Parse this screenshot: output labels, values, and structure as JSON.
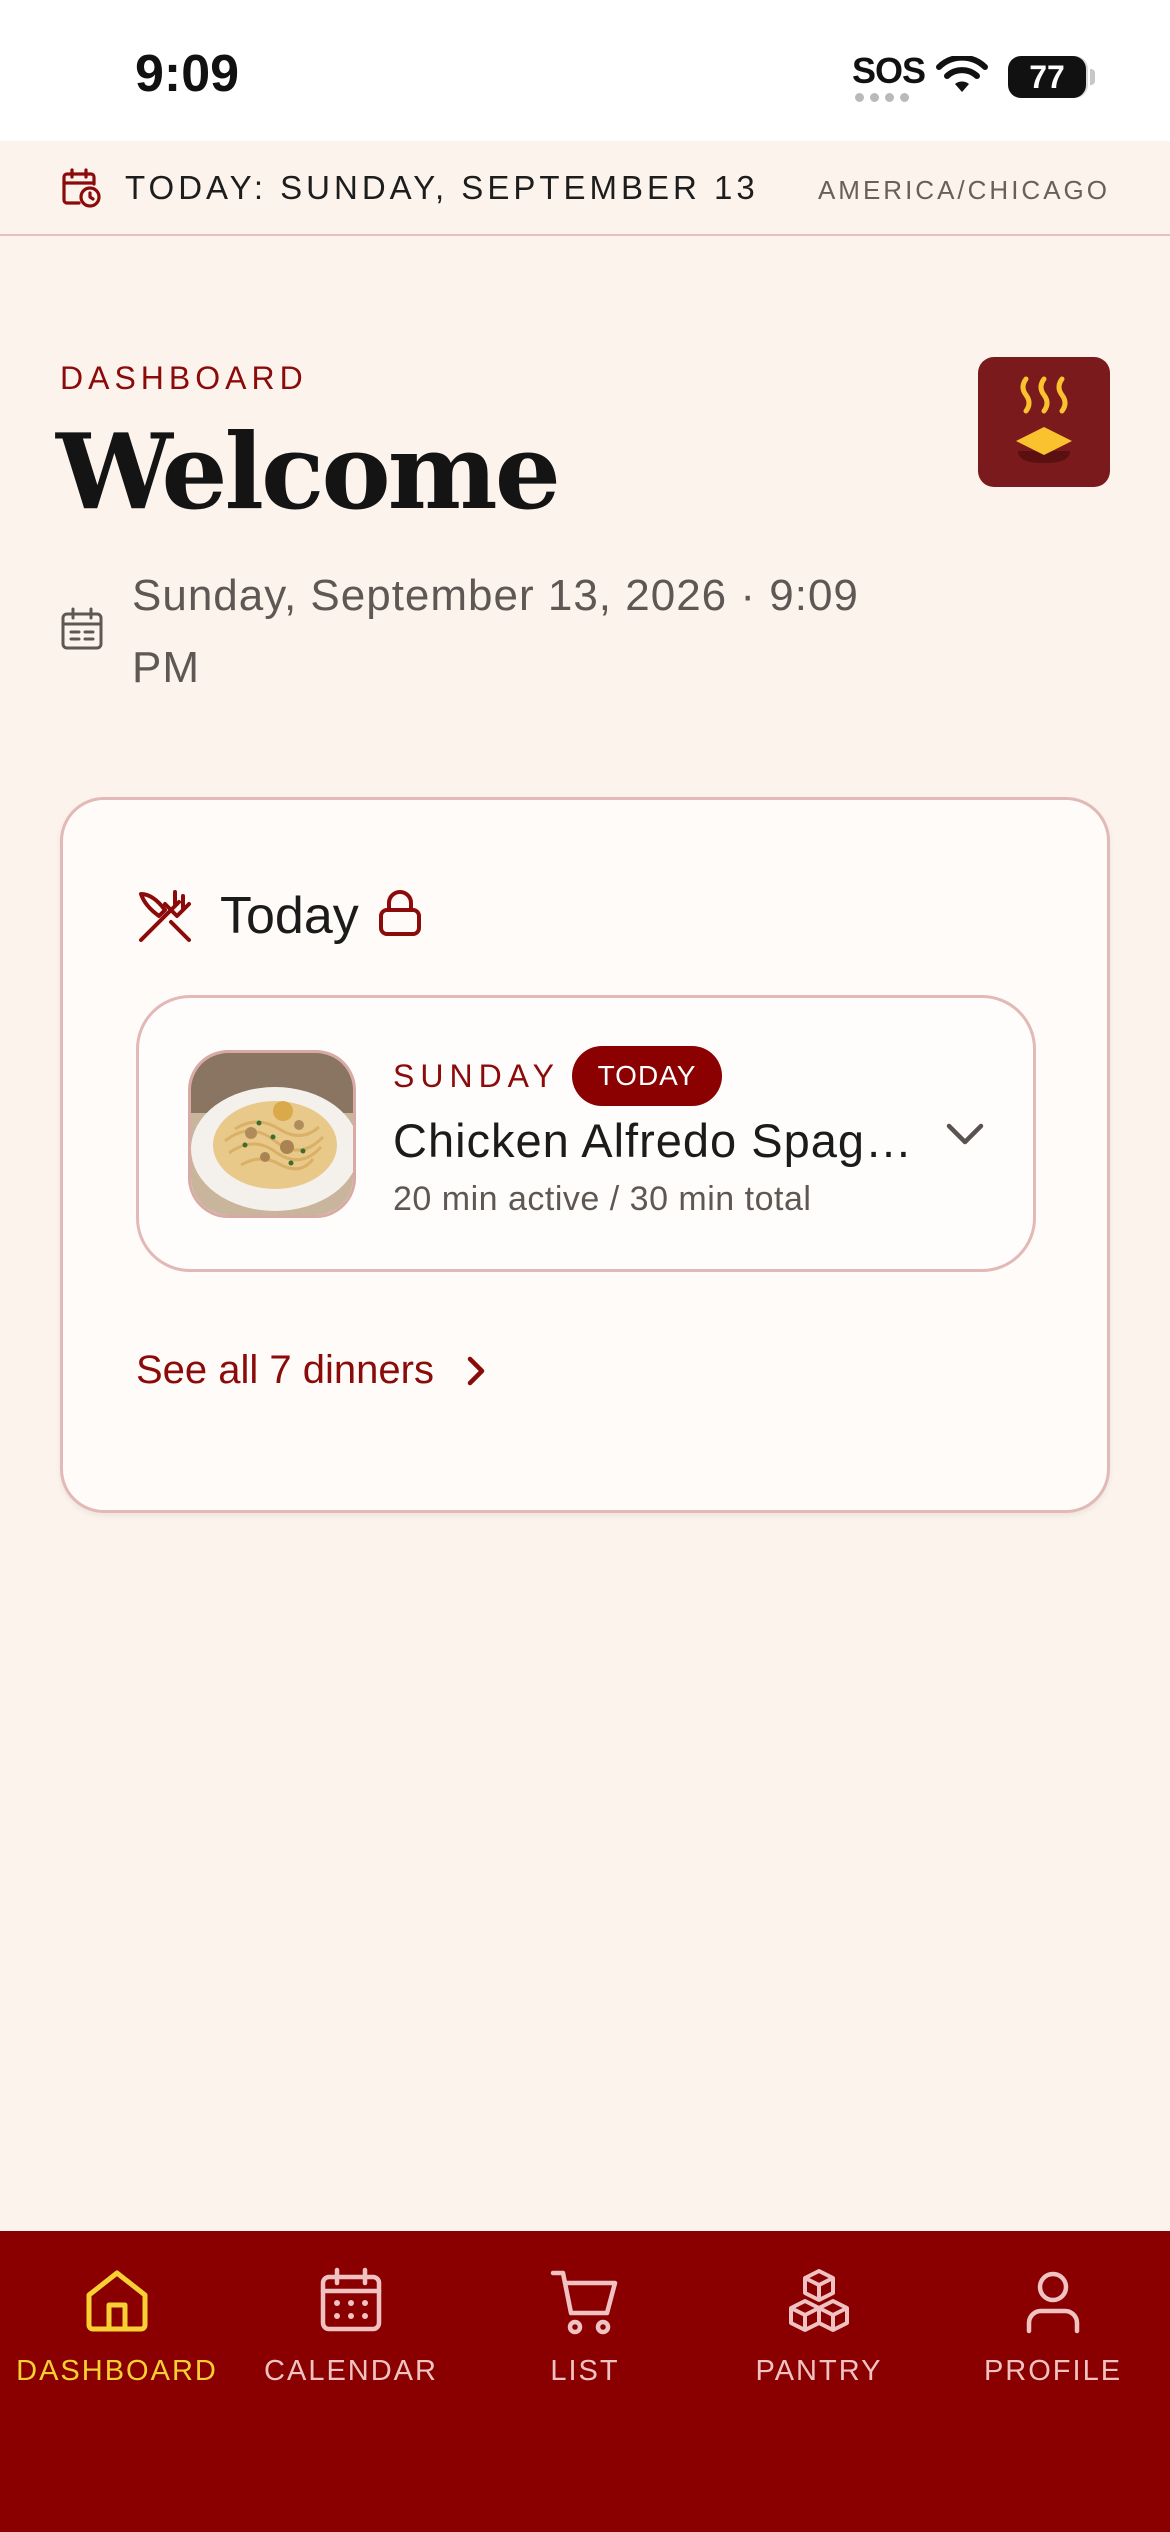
{
  "status_bar": {
    "time": "9:09",
    "sos": "SOS",
    "battery": "77"
  },
  "banner": {
    "date_text": "TODAY: SUNDAY, SEPTEMBER 13",
    "timezone": "AMERICA/CHICAGO",
    "icon": "calendar-clock-icon"
  },
  "header": {
    "eyebrow": "DASHBOARD",
    "title": "Welcome",
    "datetime": "Sunday, September 13, 2026 · 9:09 PM",
    "logo_icon": "steaming-dish-logo"
  },
  "today_card": {
    "title": "Today",
    "meal": {
      "day": "SUNDAY",
      "badge": "TODAY",
      "name": "Chicken Alfredo Spaghetti",
      "time": "20 min active / 30 min total"
    },
    "see_all": "See all 7 dinners"
  },
  "tabs": [
    {
      "label": "DASHBOARD",
      "icon": "home-icon",
      "active": true
    },
    {
      "label": "CALENDAR",
      "icon": "calendar-icon",
      "active": false
    },
    {
      "label": "LIST",
      "icon": "cart-icon",
      "active": false
    },
    {
      "label": "PANTRY",
      "icon": "boxes-icon",
      "active": false
    },
    {
      "label": "PROFILE",
      "icon": "user-icon",
      "active": false
    }
  ],
  "colors": {
    "brand": "#8b0000",
    "accent": "#f9d033",
    "background": "#fbf3ec"
  }
}
